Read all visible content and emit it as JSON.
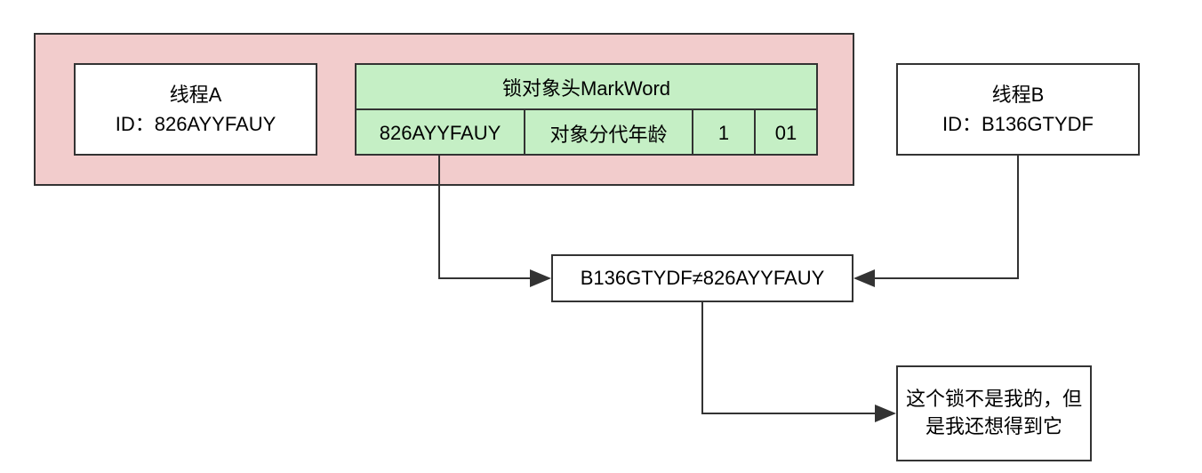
{
  "threadA": {
    "title": "线程A",
    "idLabel": "ID：826AYYFAUY"
  },
  "threadB": {
    "title": "线程B",
    "idLabel": "ID：B136GTYDF"
  },
  "markword": {
    "header": "锁对象头MarkWord",
    "threadId": "826AYYFAUY",
    "age": "对象分代年龄",
    "biasedFlag": "1",
    "lockTag": "01"
  },
  "compare": {
    "text": "B136GTYDF≠826AYYFAUY"
  },
  "result": {
    "text": "这个锁不是我的，但是我还想得到它"
  }
}
